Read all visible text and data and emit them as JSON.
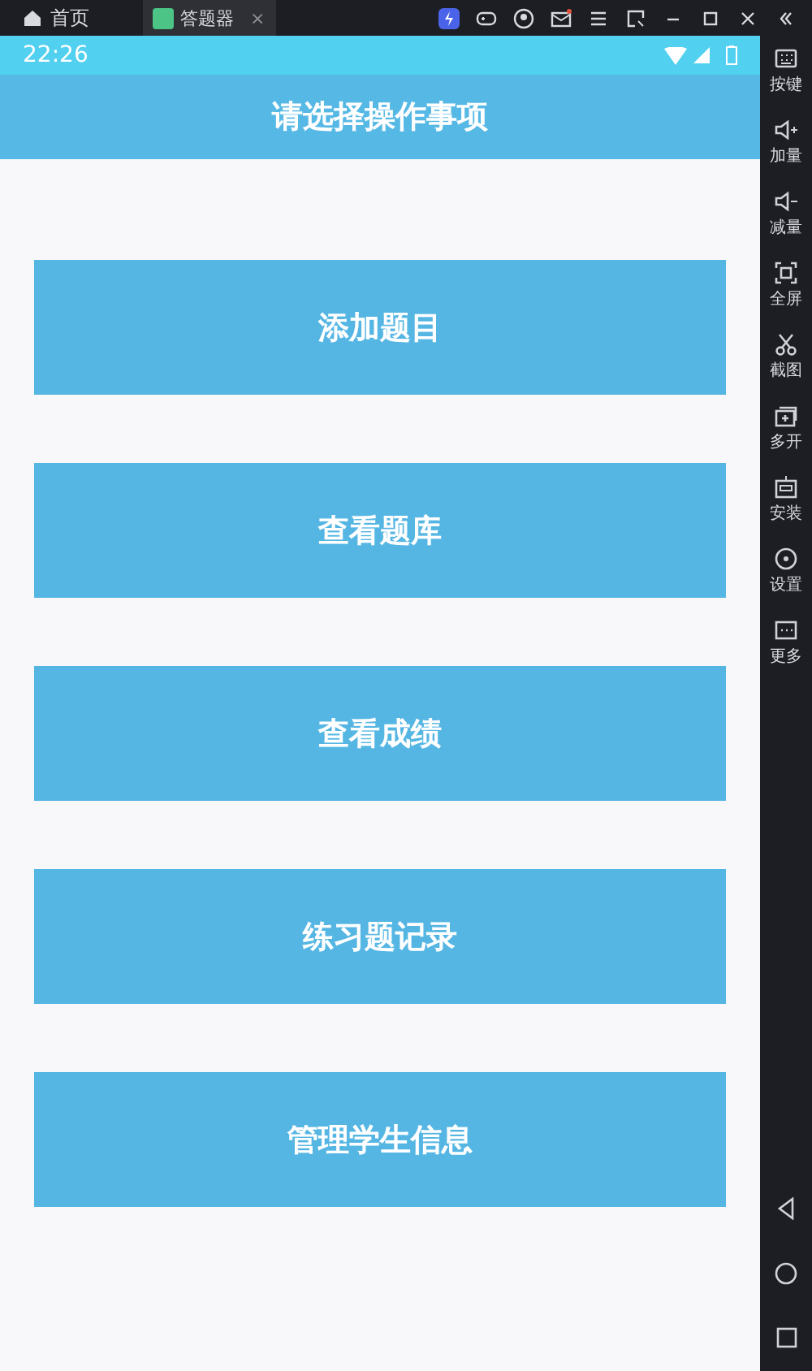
{
  "emulator_tabs": [
    {
      "label": "首页",
      "selected": false,
      "kind": "home"
    },
    {
      "label": "答题器",
      "selected": true,
      "kind": "app",
      "close": "×"
    }
  ],
  "status_bar": {
    "time": "22:26"
  },
  "app_bar": {
    "title": "请选择操作事项"
  },
  "menu_buttons": [
    {
      "label": "添加题目"
    },
    {
      "label": "查看题库"
    },
    {
      "label": "查看成绩"
    },
    {
      "label": "练习题记录"
    },
    {
      "label": "管理学生信息"
    }
  ],
  "side_toolbar": [
    {
      "label": "按键"
    },
    {
      "label": "加量"
    },
    {
      "label": "减量"
    },
    {
      "label": "全屏"
    },
    {
      "label": "截图"
    },
    {
      "label": "多开"
    },
    {
      "label": "安装"
    },
    {
      "label": "设置"
    },
    {
      "label": "更多"
    }
  ]
}
